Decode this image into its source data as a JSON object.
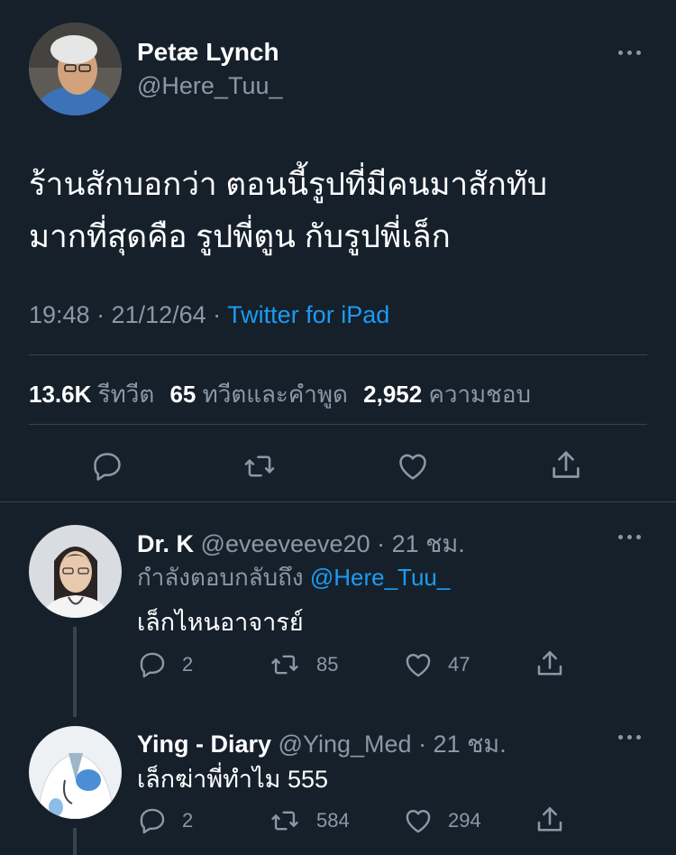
{
  "main_tweet": {
    "author_name": "Petæ Lynch",
    "author_handle": "@Here_Tuu_",
    "text_line1": "ร้านสักบอกว่า ตอนนี้รูปที่มีคนมาสักทับ",
    "text_line2": "มากที่สุดคือ รูปพี่ตูน กับรูปพี่เล็ก",
    "time": "19:48 · 21/12/64 · ",
    "source": "Twitter for iPad",
    "stats": {
      "retweets_count": "13.6K",
      "retweets_label": "รีทวีต",
      "quotes_count": "65",
      "quotes_label": "ทวีตและคำพูด",
      "likes_count": "2,952",
      "likes_label": "ความชอบ"
    },
    "actions": [
      "reply-icon",
      "retweet-icon",
      "like-icon",
      "share-icon"
    ]
  },
  "replies": [
    {
      "author_name": "Dr. K",
      "author_handle": "@eveeveeve20",
      "time": "· 21 ชม.",
      "replying_to_prefix": "กำลังตอบกลับถึง ",
      "replying_to_handle": "@Here_Tuu_",
      "text": "เล็กไหนอาจารย์",
      "reply_count": "2",
      "retweet_count": "85",
      "like_count": "47"
    },
    {
      "author_name": "Ying - Diary",
      "author_handle": "@Ying_Med",
      "time": "· 21 ชม.",
      "text": "เล็กฆ่าพี่ทำไม 555",
      "reply_count": "2",
      "retweet_count": "584",
      "like_count": "294"
    }
  ],
  "colors": {
    "background": "#15202b",
    "text": "#ffffff",
    "muted": "#8b98a5",
    "link": "#1d9bf0",
    "divider": "#38444d"
  }
}
